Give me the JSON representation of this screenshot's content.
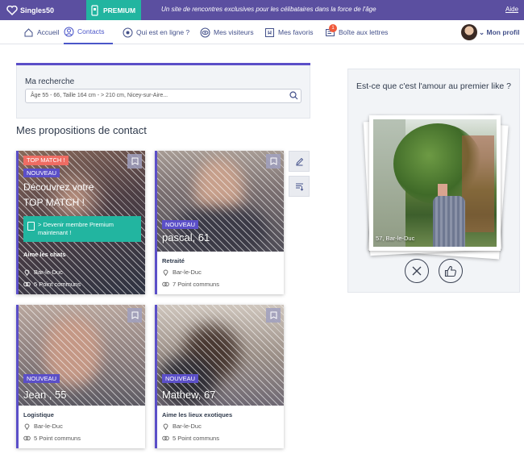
{
  "topbar": {
    "brand": "Singles50",
    "premium_label": "PREMIUM",
    "tagline": "Un site de rencontres exclusives pour les célibataires dans la force de l'âge",
    "help": "Aide"
  },
  "nav": {
    "items": [
      {
        "label": "Accueil",
        "icon": "home-icon"
      },
      {
        "label": "Contacts",
        "icon": "contacts-icon"
      },
      {
        "label": "Qui est en ligne ?",
        "icon": "online-icon"
      },
      {
        "label": "Mes visiteurs",
        "icon": "eye-icon"
      },
      {
        "label": "Mes favoris",
        "icon": "bookmark-icon"
      },
      {
        "label": "Boîte aux lettres",
        "icon": "mail-icon"
      }
    ],
    "active": "Contacts",
    "mail_badge": "1",
    "profile_label": "Mon profil"
  },
  "search": {
    "title": "Ma recherche",
    "value": "Âge 55 - 66, Taille 164 cm - > 210 cm, Nicey-sur-Aire..."
  },
  "section_title": "Mes propositions de contact",
  "cards": [
    {
      "badge_top": "TOP MATCH !",
      "badge_new": "NOUVEAU",
      "title_line1": "Découvrez votre",
      "title_line2": "TOP MATCH !",
      "cta_line1": "> Devenir membre Premium",
      "cta_line2": "maintenant !",
      "trait": "Aime les chats",
      "city": "Bar-le-Duc",
      "common": "5 Point communs"
    },
    {
      "badge_new": "NOUVEAU",
      "name": "pascal, 61",
      "trait": "Retraité",
      "city": "Bar-le-Duc",
      "common": "7 Point communs"
    },
    {
      "badge_new": "NOUVEAU",
      "name": "Jean , 55",
      "trait": "Logistique",
      "city": "Bar-le-Duc",
      "common": "5 Point communs"
    },
    {
      "badge_new": "NOUVEAU",
      "name": "Mathew, 67",
      "trait": "Aime les lieux exotiques",
      "city": "Bar-le-Duc",
      "common": "5 Point communs"
    }
  ],
  "like_panel": {
    "question": "Est-ce que c'est l'amour au premier like ?",
    "caption": "57, Bar-le-Duc"
  },
  "colors": {
    "brand": "#5b4fa0",
    "premium": "#22b5a0",
    "accent": "#5b4fc8",
    "top_match": "#ee6c63"
  }
}
